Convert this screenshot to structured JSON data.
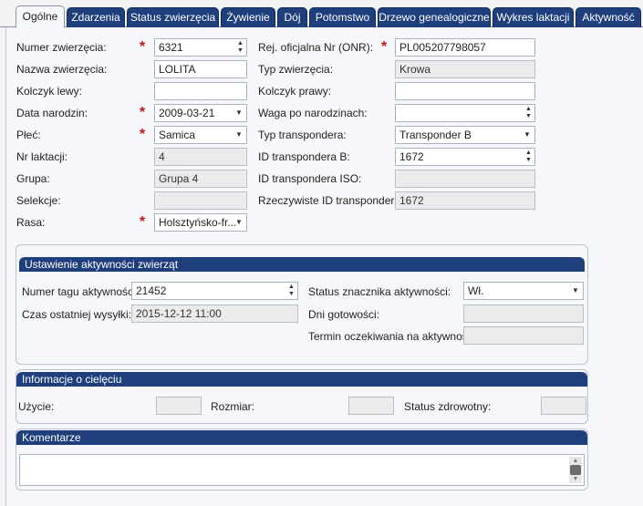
{
  "tabs": [
    {
      "label": "Ogólne",
      "active": true
    },
    {
      "label": "Zdarzenia"
    },
    {
      "label": "Status zwierzęcia"
    },
    {
      "label": "Żywienie"
    },
    {
      "label": "Dój"
    },
    {
      "label": "Potomstwo"
    },
    {
      "label": "Drzewo genealogiczne"
    },
    {
      "label": "Wykres laktacji"
    },
    {
      "label": "Aktywność"
    }
  ],
  "left": {
    "animal_number_label": "Numer zwierzęcia:",
    "animal_number_value": "6321",
    "animal_name_label": "Nazwa zwierzęcia:",
    "animal_name_value": "LOLITA",
    "left_tag_label": "Kolczyk lewy:",
    "left_tag_value": "",
    "birth_date_label": "Data narodzin:",
    "birth_date_value": "2009-03-21",
    "sex_label": "Płeć:",
    "sex_value": "Samica",
    "lactation_label": "Nr laktacji:",
    "lactation_value": "4",
    "group_label": "Grupa:",
    "group_value": "Grupa 4",
    "selection_label": "Selekcje:",
    "selection_value": "",
    "breed_label": "Rasa:",
    "breed_value": "Holsztyńsko-fr..."
  },
  "right": {
    "onr_label": "Rej. oficjalna Nr (ONR):",
    "onr_value": "PL005207798057",
    "animal_type_label": "Typ zwierzęcia:",
    "animal_type_value": "Krowa",
    "right_tag_label": "Kolczyk prawy:",
    "right_tag_value": "",
    "birth_weight_label": "Waga po narodzinach:",
    "birth_weight_value": "",
    "transponder_type_label": "Typ transpondera:",
    "transponder_type_value": "Transponder B",
    "transponder_b_label": "ID transpondera B:",
    "transponder_b_value": "1672",
    "transponder_iso_label": "ID transpondera ISO:",
    "transponder_iso_value": "",
    "real_transponder_label": "Rzeczywiste ID transpondera:",
    "real_transponder_value": "1672"
  },
  "activity": {
    "title": "Ustawienie aktywności zwierząt",
    "tag_number_label": "Numer tagu aktywności:",
    "tag_number_value": "21452",
    "last_send_label": "Czas ostatniej wysyłki:",
    "last_send_value": "2015-12-12 11:00",
    "tag_status_label": "Status znacznika aktywności:",
    "tag_status_value": "Wł.",
    "readiness_label": "Dni gotowości:",
    "readiness_value": "",
    "wait_label": "Termin oczekiwania na aktywność:",
    "wait_value": ""
  },
  "calf": {
    "title": "Informacje o cielęciu",
    "use_label": "Użycie:",
    "use_value": "",
    "size_label": "Rozmiar:",
    "size_value": "",
    "health_label": "Status zdrowotny:",
    "health_value": ""
  },
  "comments": {
    "title": "Komentarze",
    "value": ""
  },
  "required_mark": "*",
  "icons": {
    "spinner": "spinner-icon",
    "dropdown": "chevron-down-icon"
  },
  "colors": {
    "tab_bg": "#1e3f7c",
    "header_bg": "#1e3f7c",
    "required": "#c8141e",
    "readonly_bg": "#ebebeb"
  }
}
